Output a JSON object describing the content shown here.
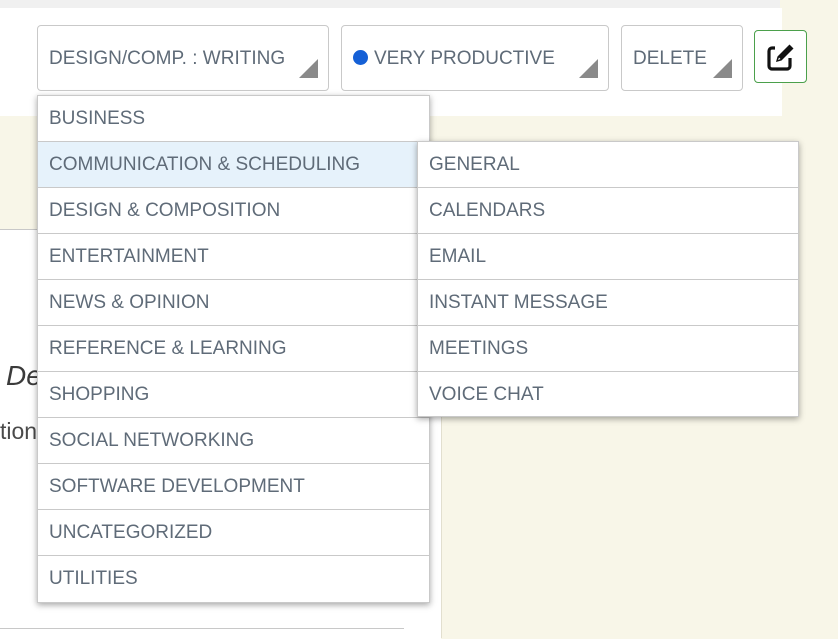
{
  "toolbar": {
    "category_select": "DESIGN/COMP. : WRITING",
    "productivity_select": "VERY PRODUCTIVE",
    "productivity_dot_color": "#1560d6",
    "delete_select": "DELETE",
    "edit_icon": "edit-icon"
  },
  "background": {
    "partial_heading": "De",
    "partial_line": "tion"
  },
  "category_menu": {
    "items": [
      "BUSINESS",
      "COMMUNICATION & SCHEDULING",
      "DESIGN & COMPOSITION",
      "ENTERTAINMENT",
      "NEWS & OPINION",
      "REFERENCE & LEARNING",
      "SHOPPING",
      "SOCIAL NETWORKING",
      "SOFTWARE DEVELOPMENT",
      "UNCATEGORIZED",
      "UTILITIES"
    ],
    "highlighted": "COMMUNICATION & SCHEDULING"
  },
  "subcategory_menu": {
    "items": [
      "GENERAL",
      "CALENDARS",
      "EMAIL",
      "INSTANT MESSAGE",
      "MEETINGS",
      "VOICE CHAT"
    ]
  },
  "colors": {
    "highlight": "#e6f2fb",
    "edit_border": "#4ba04b",
    "text": "#5f6b78"
  }
}
